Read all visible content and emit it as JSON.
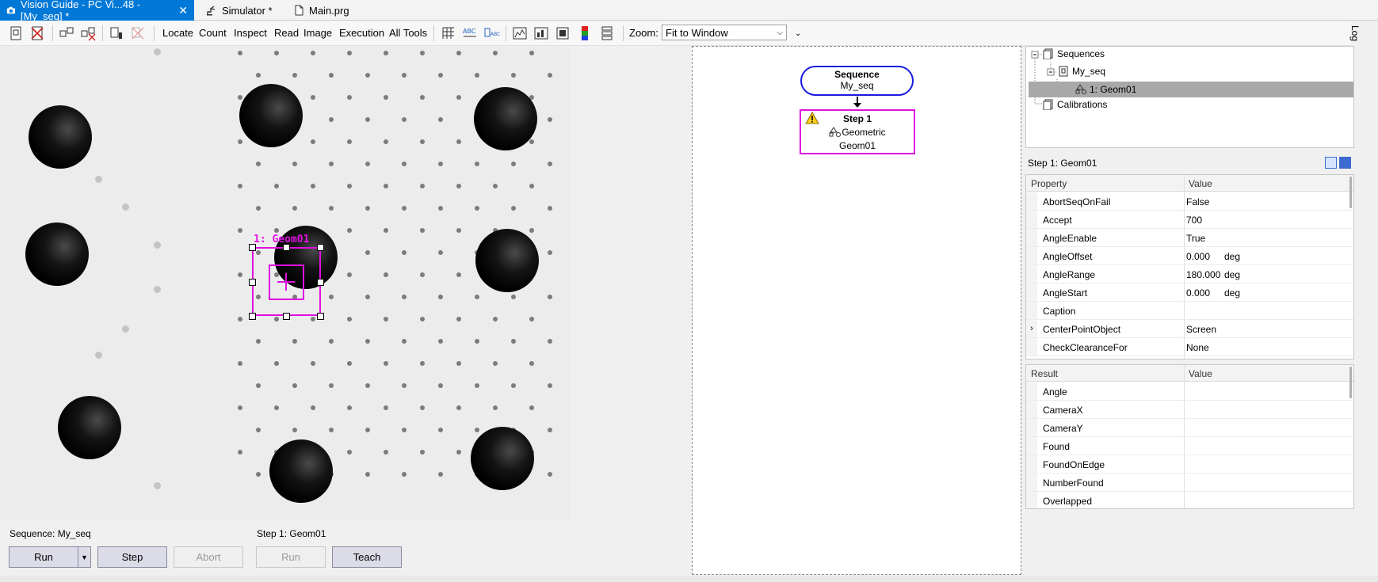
{
  "tabs": [
    {
      "label": "Vision Guide - PC Vi...48 - [My_seq] *",
      "active": true
    },
    {
      "label": "Simulator *",
      "active": false
    },
    {
      "label": "Main.prg",
      "active": false
    }
  ],
  "toolbar": {
    "menus": [
      "Locate",
      "Count",
      "Inspect",
      "Read",
      "Image",
      "Execution",
      "All Tools"
    ],
    "zoom_label": "Zoom:",
    "zoom_value": "Fit to Window",
    "side_tab": "Log"
  },
  "image_overlay": {
    "label": "1: Geom01",
    "color": "#e010e0"
  },
  "controls": {
    "sequence_label": "Sequence: My_seq",
    "step_label": "Step 1: Geom01",
    "run": "Run",
    "step": "Step",
    "abort": "Abort",
    "run2": "Run",
    "teach": "Teach"
  },
  "flowchart": {
    "sequence_title": "Sequence",
    "sequence_name": "My_seq",
    "step_title": "Step 1",
    "step_type": "Geometric",
    "step_name": "Geom01"
  },
  "tree": {
    "items": [
      {
        "label": "Sequences"
      },
      {
        "label": "My_seq"
      },
      {
        "label": "1: Geom01",
        "selected": true
      },
      {
        "label": "Calibrations"
      }
    ]
  },
  "step_panel_title": "Step 1: Geom01",
  "properties": {
    "headers": [
      "Property",
      "Value"
    ],
    "rows": [
      {
        "name": "AbortSeqOnFail",
        "value": "False",
        "unit": ""
      },
      {
        "name": "Accept",
        "value": "700",
        "unit": ""
      },
      {
        "name": "AngleEnable",
        "value": "True",
        "unit": ""
      },
      {
        "name": "AngleOffset",
        "value": "0.000",
        "unit": "deg"
      },
      {
        "name": "AngleRange",
        "value": "180.000",
        "unit": "deg"
      },
      {
        "name": "AngleStart",
        "value": "0.000",
        "unit": "deg"
      },
      {
        "name": "Caption",
        "value": "",
        "unit": ""
      },
      {
        "name": "CenterPointObject",
        "value": "Screen",
        "unit": "",
        "expandable": true
      },
      {
        "name": "CheckClearanceFor",
        "value": "None",
        "unit": ""
      }
    ]
  },
  "results": {
    "headers": [
      "Result",
      "Value"
    ],
    "rows": [
      {
        "name": "Angle",
        "value": ""
      },
      {
        "name": "CameraX",
        "value": ""
      },
      {
        "name": "CameraY",
        "value": ""
      },
      {
        "name": "Found",
        "value": ""
      },
      {
        "name": "FoundOnEdge",
        "value": ""
      },
      {
        "name": "NumberFound",
        "value": ""
      },
      {
        "name": "Overlapped",
        "value": ""
      }
    ]
  }
}
